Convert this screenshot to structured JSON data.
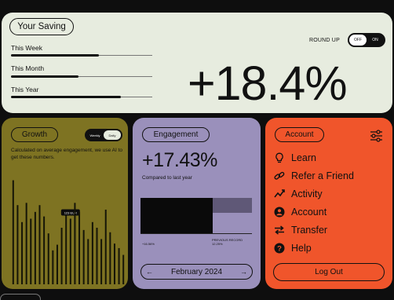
{
  "saving": {
    "title": "Your Saving",
    "round_up_label": "ROUND UP",
    "toggle": {
      "off": "OFF",
      "on": "ON",
      "state": "off"
    },
    "periods": [
      {
        "label": "This Week",
        "level": 0.62
      },
      {
        "label": "This Month",
        "level": 0.48
      },
      {
        "label": "This Year",
        "level": 0.78
      }
    ],
    "percent": "+18.4%"
  },
  "growth": {
    "title": "Growth",
    "toggle": {
      "a": "Weekly",
      "b": "Daily",
      "selected": "b"
    },
    "description": "Calculated on average engagement, we use AI to get these numbers.",
    "highlight_label": "123 EUR",
    "chart_data": {
      "type": "bar",
      "values": [
        92,
        70,
        55,
        72,
        58,
        64,
        70,
        60,
        45,
        30,
        35,
        50,
        62,
        58,
        72,
        64,
        48,
        40,
        55,
        50,
        40,
        66,
        46,
        36,
        32,
        26
      ],
      "highlight_index": 13,
      "ylim": [
        0,
        100
      ]
    }
  },
  "engagement": {
    "title": "Engagement",
    "value": "+17.43%",
    "subtitle": "Compared to last year",
    "chart_data": {
      "type": "bar",
      "values": [
        1,
        0.43
      ],
      "bar_labels": [
        "+16.56%",
        "PREVIOUS RECORD 12.25%"
      ]
    },
    "month": "February 2024",
    "prev_arrow": "←",
    "next_arrow": "→"
  },
  "account": {
    "title": "Account",
    "menu": [
      {
        "label": "Learn",
        "icon": "lightbulb-icon"
      },
      {
        "label": "Refer a Friend",
        "icon": "link-icon"
      },
      {
        "label": "Activity",
        "icon": "activity-icon"
      },
      {
        "label": "Account",
        "icon": "user-icon"
      },
      {
        "label": "Transfer",
        "icon": "transfer-icon"
      },
      {
        "label": "Help",
        "icon": "help-icon"
      }
    ],
    "logout": "Log Out"
  },
  "colors": {
    "saving_bg": "#e7ecdf",
    "growth_bg": "#7e7322",
    "engagement_bg": "#9a90bb",
    "account_bg": "#f0552b"
  }
}
